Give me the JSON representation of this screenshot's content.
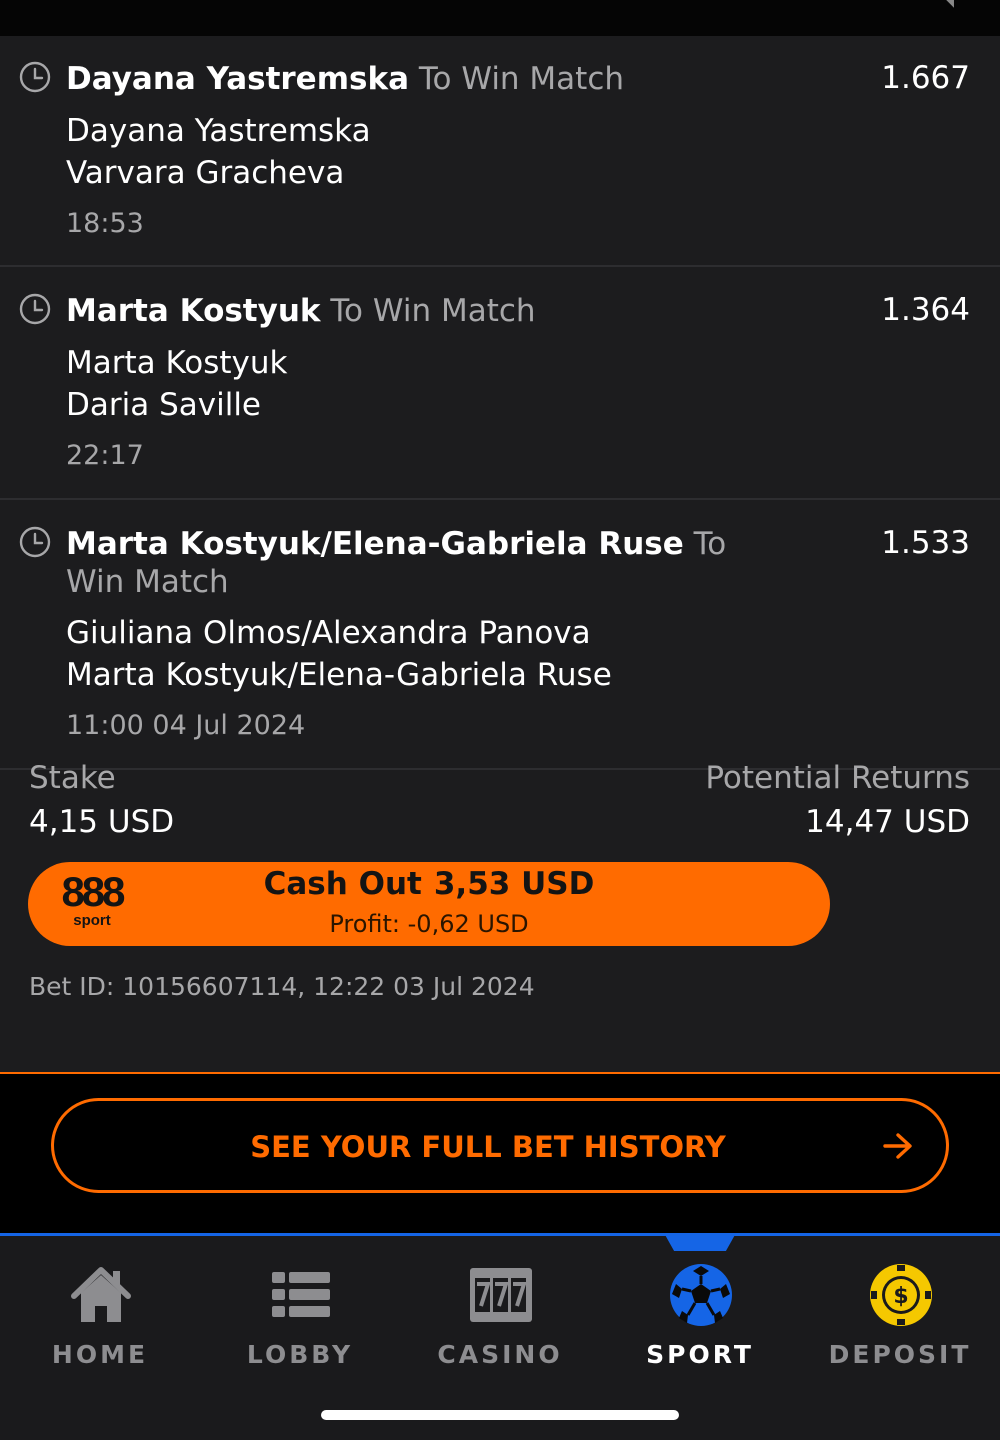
{
  "selections": [
    {
      "pick": "Dayana Yastremska",
      "market": "To Win Match",
      "odds": "1.667",
      "team1": "Dayana Yastremska",
      "team2": "Varvara Gracheva",
      "time": "18:53"
    },
    {
      "pick": "Marta Kostyuk",
      "market": "To Win Match",
      "odds": "1.364",
      "team1": "Marta Kostyuk",
      "team2": "Daria Saville",
      "time": "22:17"
    },
    {
      "pick": "Marta Kostyuk/Elena-Gabriela Ruse",
      "market": "To Win Match",
      "odds": "1.533",
      "team1": "Giuliana Olmos/Alexandra Panova",
      "team2": "Marta Kostyuk/Elena-Gabriela Ruse",
      "time": "11:00 04 Jul 2024"
    }
  ],
  "summary": {
    "stake_label": "Stake",
    "stake_value": "4,15 USD",
    "returns_label": "Potential Returns",
    "returns_value": "14,47 USD"
  },
  "cashout": {
    "logo_top": "888",
    "logo_bottom": "sport",
    "label": "Cash Out",
    "amount": "3,53 USD",
    "profit": "Profit: -0,62 USD"
  },
  "bet_id": "Bet ID: 10156607114, 12:22 03 Jul 2024",
  "history_button": "SEE YOUR FULL BET HISTORY",
  "nav": {
    "items": [
      {
        "label": "HOME",
        "icon": "home-icon"
      },
      {
        "label": "LOBBY",
        "icon": "list-icon"
      },
      {
        "label": "CASINO",
        "icon": "slot-777-icon"
      },
      {
        "label": "SPORT",
        "icon": "soccer-ball-icon",
        "active": true
      },
      {
        "label": "DEPOSIT",
        "icon": "dollar-coin-icon"
      }
    ]
  },
  "colors": {
    "accent": "#ff6b00",
    "nav_active": "#1565e6",
    "deposit_coin": "#f5c800",
    "card_bg": "#1c1c1e"
  }
}
